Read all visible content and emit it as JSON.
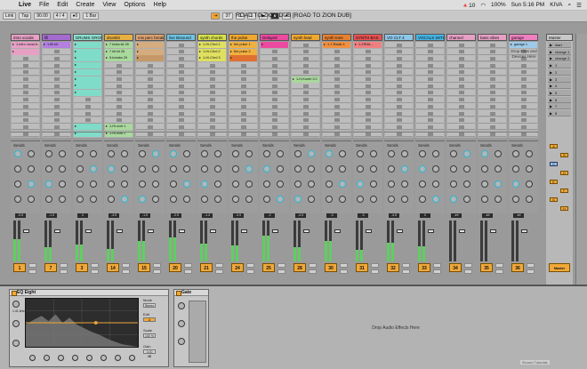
{
  "menubar": {
    "menus": [
      "Live",
      "File",
      "Edit",
      "Create",
      "View",
      "Options",
      "Help"
    ],
    "status": [
      "🔺10",
      "100%",
      "Sun 5:16 PM",
      "KIVA"
    ]
  },
  "transport": {
    "left": [
      "Link",
      "Tap",
      "90.00",
      "4 / 4",
      "●0",
      "1 Bar"
    ],
    "center": [
      "37",
      "1",
      "1"
    ],
    "right": [
      "1",
      "1",
      "1",
      "4",
      "0",
      "0"
    ],
    "title": "ROAD TO ZION DUB  [ROAD TO ZION DUB]"
  },
  "tracks": [
    {
      "name": "intro vocals",
      "color": "#e7a0c4",
      "num": "1",
      "vol": "-0.5",
      "meter": 0.55,
      "clips": [
        {
          "row": 0,
          "label": "1-intro vocal A...",
          "color": "#e7a0c4"
        },
        {
          "row": 1,
          "label": "",
          "color": "#e7a0c4"
        }
      ]
    },
    {
      "name": "fill",
      "color": "#a46ad0",
      "num": "7",
      "vol": "-1.5",
      "meter": 0.35,
      "clips": [
        {
          "row": 0,
          "label": "1-fill kit",
          "color": "#b37fe0"
        }
      ]
    },
    {
      "name": "DRUMS GROUP",
      "color": "#8fe0d0",
      "num": "3",
      "vol": "0",
      "meter": 0.42,
      "clips": [
        {
          "row": 0,
          "label": "",
          "color": "#7fdcc8"
        },
        {
          "row": 1,
          "label": "",
          "color": "#7fdcc8"
        },
        {
          "row": 2,
          "label": "",
          "color": "#7fdcc8"
        },
        {
          "row": 3,
          "label": "",
          "color": "#7fdcc8"
        },
        {
          "row": 4,
          "label": "",
          "color": "#7fdcc8"
        },
        {
          "row": 5,
          "label": "",
          "color": "#7fdcc8"
        },
        {
          "row": 6,
          "label": "",
          "color": "#7fdcc8"
        },
        {
          "row": 7,
          "label": "",
          "color": "#7fdcc8"
        },
        {
          "row": 12,
          "label": "",
          "color": "#7fdcc8"
        },
        {
          "row": 13,
          "label": "",
          "color": "#7fdcc8"
        }
      ]
    },
    {
      "name": "drumkit",
      "color": "#e8b040",
      "num": "14",
      "vol": "-4.5",
      "meter": 0.3,
      "clips": [
        {
          "row": 0,
          "label": "7 kicks kit 28",
          "color": "#a9d99d"
        },
        {
          "row": 1,
          "label": "7 kit kit 28",
          "color": "#a9d99d"
        },
        {
          "row": 2,
          "label": "5-breaks 29",
          "color": "#a9d99d"
        },
        {
          "row": 12,
          "label": "1-Hi-ccnt 1",
          "color": "#a9d99d"
        },
        {
          "row": 13,
          "label": "1-Hi-ccnt 2",
          "color": "#a9d99d"
        }
      ]
    },
    {
      "name": "mix perc break",
      "color": "#dca270",
      "num": "15",
      "vol": "-1.5",
      "meter": 0.5,
      "clips": [
        {
          "row": 0,
          "label": "",
          "color": "#d4ac80"
        },
        {
          "row": 1,
          "label": "",
          "color": "#d4ac80"
        },
        {
          "row": 2,
          "label": "",
          "color": "#c49868"
        }
      ]
    },
    {
      "name": "live kitsound",
      "color": "#6fc3e3",
      "num": "20",
      "vol": "-2.5",
      "meter": 0.58,
      "clips": []
    },
    {
      "name": "synth chords",
      "color": "#d8e24a",
      "num": "21",
      "vol": "-1.4",
      "meter": 0.44,
      "clips": [
        {
          "row": 0,
          "label": "1-Hi-Chrd 1",
          "color": "#e0e060"
        },
        {
          "row": 1,
          "label": "1-Hi-Chrd 2",
          "color": "#e0e060"
        },
        {
          "row": 2,
          "label": "1-Hi-Chrd 3",
          "color": "#e0e060"
        }
      ]
    },
    {
      "name": "the pulse",
      "color": "#f0a830",
      "num": "24",
      "vol": "-3.9",
      "meter": 0.4,
      "clips": [
        {
          "row": 0,
          "label": "the pulse 1",
          "color": "#f0b040"
        },
        {
          "row": 1,
          "label": "the pulse 2",
          "color": "#f0b040"
        },
        {
          "row": 2,
          "label": "",
          "color": "#e07030"
        }
      ]
    },
    {
      "name": "Delayed",
      "color": "#ec4aa0",
      "num": "25",
      "vol": "-2",
      "meter": 0.62,
      "clips": [
        {
          "row": 0,
          "label": "",
          "color": "#ec4aa0"
        }
      ]
    },
    {
      "name": "synth lead",
      "color": "#f0a830",
      "num": "28",
      "vol": "-4.5",
      "meter": 0.35,
      "clips": [
        {
          "row": 5,
          "label": "1-H-Kontrl 3.0",
          "color": "#a9d99d"
        }
      ]
    },
    {
      "name": "synth tone",
      "color": "#e98030",
      "num": "30",
      "vol": "-3",
      "meter": 0.5,
      "clips": [
        {
          "row": 0,
          "label": "1-7-Radio 1",
          "color": "#f09040"
        }
      ]
    },
    {
      "name": "SYNTH BAS",
      "color": "#e85050",
      "num": "31",
      "vol": "-3",
      "meter": 0.28,
      "clips": [
        {
          "row": 0,
          "label": "1-ZSNA...",
          "color": "#f08080"
        }
      ]
    },
    {
      "name": "VO CLT 4",
      "color": "#8cc6e8",
      "num": "32",
      "vol": "-4.5",
      "meter": 0.46,
      "clips": []
    },
    {
      "name": "VOCALS WITH",
      "color": "#45b6e6",
      "num": "33",
      "vol": "0",
      "meter": 0.36,
      "clips": []
    },
    {
      "name": "channel",
      "color": "#e7a0c4",
      "num": "34",
      "vol": "-inf",
      "meter": 0.0,
      "clips": []
    },
    {
      "name": "bass vibes",
      "color": "#e7a0c4",
      "num": "35",
      "vol": "-inf",
      "meter": 0.0,
      "clips": []
    },
    {
      "name": "garage",
      "color": "#ef7fc0",
      "num": "36",
      "vol": "-inf",
      "meter": 0.0,
      "clips": [
        {
          "row": 0,
          "label": "garage 1",
          "color": "#9fc9e8"
        }
      ]
    }
  ],
  "drop_files": "Drop Files and Devices Here",
  "master": {
    "name": "Master",
    "scenes": [
      "start",
      "change 1",
      "change 2",
      "1",
      "2",
      "3",
      "4",
      "5",
      "6",
      "7",
      "8"
    ],
    "returns": [
      "A",
      "B",
      "C",
      "D",
      "E",
      "F",
      "G",
      "H"
    ],
    "num": "Master"
  },
  "eq": {
    "title": "EQ Eight",
    "mode": "Mode",
    "mode_val": "Stereo",
    "edit": "Edit",
    "scale": "Scale",
    "gain": "Gain",
    "gain_val": "0.00 dB",
    "scale_val": "100 %",
    "freq": "Freq",
    "freq_val": "1.41 kHz"
  },
  "gate": {
    "title": "Gate"
  },
  "fx_drop": "Drop Audio Effects Here",
  "watermark": "iSound Tutorials"
}
